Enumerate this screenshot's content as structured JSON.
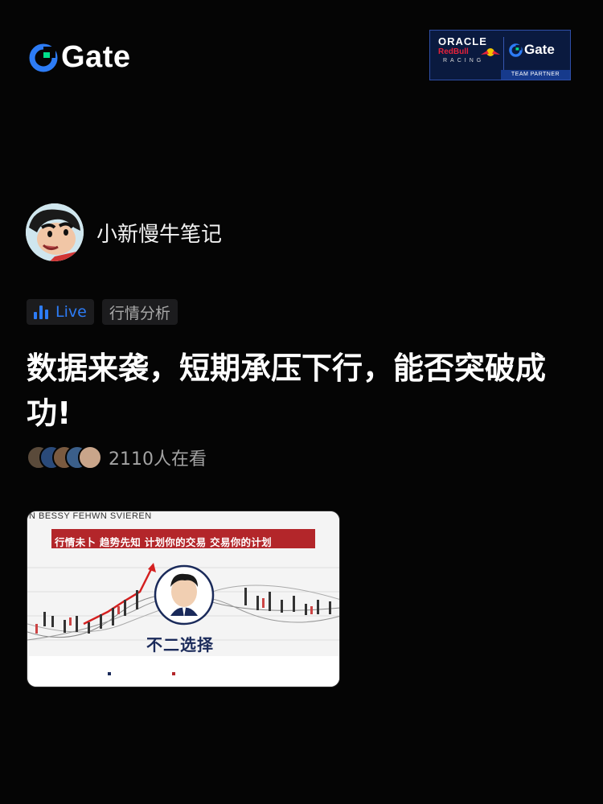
{
  "brand": {
    "name": "Gate",
    "accent": "#2d7cf6",
    "green": "#00e08a"
  },
  "partner": {
    "oracle": "ORACLE",
    "redbull": "RedBull",
    "racing": "RACING",
    "gate": "Gate",
    "badge": "TEAM PARTNER"
  },
  "author": {
    "name": "小新慢牛笔记"
  },
  "tags": {
    "live": "Live",
    "category": "行情分析"
  },
  "post": {
    "title": "数据来袭，短期承压下行，能否突破成功!"
  },
  "viewers": {
    "count_text": "2110人在看"
  },
  "card": {
    "top_overlay": "N BESSY FEHWN SVIEREN",
    "banner": "行情未卜 趋势先知 计划你的交易 交易你的计划",
    "caption": "不二选择"
  }
}
